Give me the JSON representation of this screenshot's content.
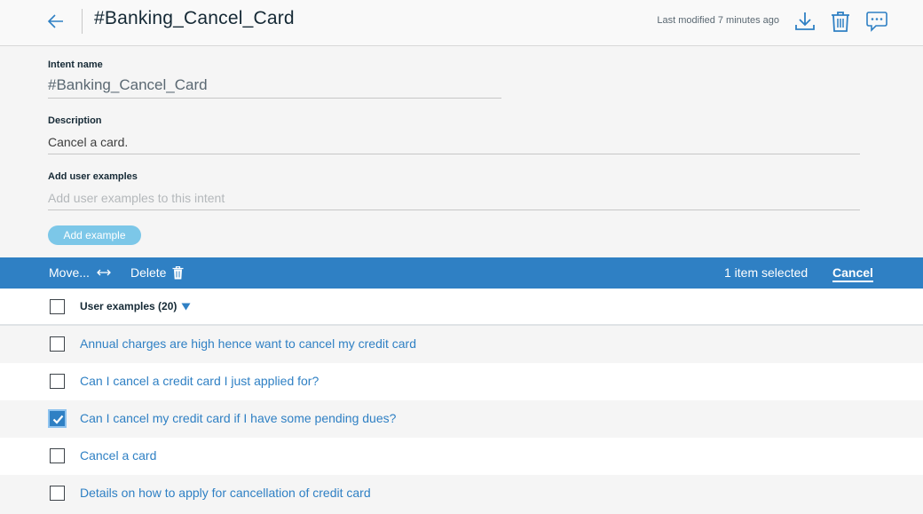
{
  "header": {
    "title": "#Banking_Cancel_Card",
    "last_modified": "Last modified 7 minutes ago",
    "back_icon": "arrow-left-icon",
    "download_icon": "download-icon",
    "trash_icon": "trash-icon",
    "chat_icon": "chat-icon"
  },
  "form": {
    "intent_label": "Intent name",
    "intent_value": "#Banking_Cancel_Card",
    "description_label": "Description",
    "description_value": "Cancel a card.",
    "examples_label": "Add user examples",
    "examples_placeholder": "Add user examples to this intent",
    "add_example_button": "Add example"
  },
  "action_bar": {
    "move_label": "Move...",
    "delete_label": "Delete",
    "selected_text": "1 item selected",
    "cancel_label": "Cancel",
    "background": "#2f80c4"
  },
  "list": {
    "header_label": "User examples (20)",
    "header_checked": false,
    "rows": [
      {
        "text": "Annual charges are high hence want to cancel my credit card",
        "checked": false
      },
      {
        "text": "Can I cancel a credit card I just applied for?",
        "checked": false
      },
      {
        "text": "Can I cancel my credit card if I have some pending dues?",
        "checked": true
      },
      {
        "text": "Cancel a card",
        "checked": false
      },
      {
        "text": "Details on how to apply for cancellation of credit card",
        "checked": false
      }
    ]
  },
  "colors": {
    "accent": "#2f80c4",
    "add_button": "#7cc7e8",
    "link_text": "#2f80c4"
  }
}
